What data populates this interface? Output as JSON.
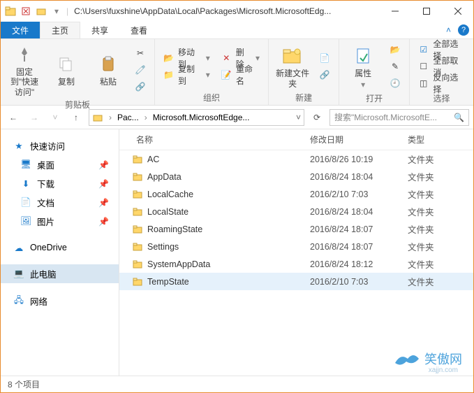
{
  "title": "C:\\Users\\fuxshine\\AppData\\Local\\Packages\\Microsoft.MicrosoftEdg...",
  "tabs": {
    "file": "文件",
    "home": "主页",
    "share": "共享",
    "view": "查看"
  },
  "ribbon": {
    "clipboard": {
      "pin": "固定到\"快速访问\"",
      "copy": "复制",
      "paste": "粘贴",
      "label": "剪贴板"
    },
    "organize": {
      "moveTo": "移动到",
      "copyTo": "复制到",
      "delete": "删除",
      "rename": "重命名",
      "label": "组织"
    },
    "newg": {
      "newFolder": "新建文件夹",
      "label": "新建"
    },
    "open": {
      "props": "属性",
      "label": "打开"
    },
    "select": {
      "all": "全部选择",
      "none": "全部取消",
      "invert": "反向选择",
      "label": "选择"
    }
  },
  "address": {
    "crumb1": "Pac...",
    "crumb2": "Microsoft.MicrosoftEdge...",
    "search": "搜索\"Microsoft.MicrosoftE..."
  },
  "nav": {
    "quick": "快速访问",
    "desktop": "桌面",
    "downloads": "下载",
    "documents": "文档",
    "pictures": "图片",
    "onedrive": "OneDrive",
    "thispc": "此电脑",
    "network": "网络"
  },
  "columns": {
    "name": "名称",
    "modified": "修改日期",
    "type": "类型"
  },
  "folderType": "文件夹",
  "rows": [
    {
      "name": "AC",
      "date": "2016/8/26 10:19"
    },
    {
      "name": "AppData",
      "date": "2016/8/24 18:04"
    },
    {
      "name": "LocalCache",
      "date": "2016/2/10 7:03"
    },
    {
      "name": "LocalState",
      "date": "2016/8/24 18:04"
    },
    {
      "name": "RoamingState",
      "date": "2016/8/24 18:07"
    },
    {
      "name": "Settings",
      "date": "2016/8/24 18:07"
    },
    {
      "name": "SystemAppData",
      "date": "2016/8/24 18:12"
    },
    {
      "name": "TempState",
      "date": "2016/2/10 7:03"
    }
  ],
  "status": "8 个项目",
  "watermark": {
    "text": "笑傲网",
    "sub": "xajjn.com"
  }
}
